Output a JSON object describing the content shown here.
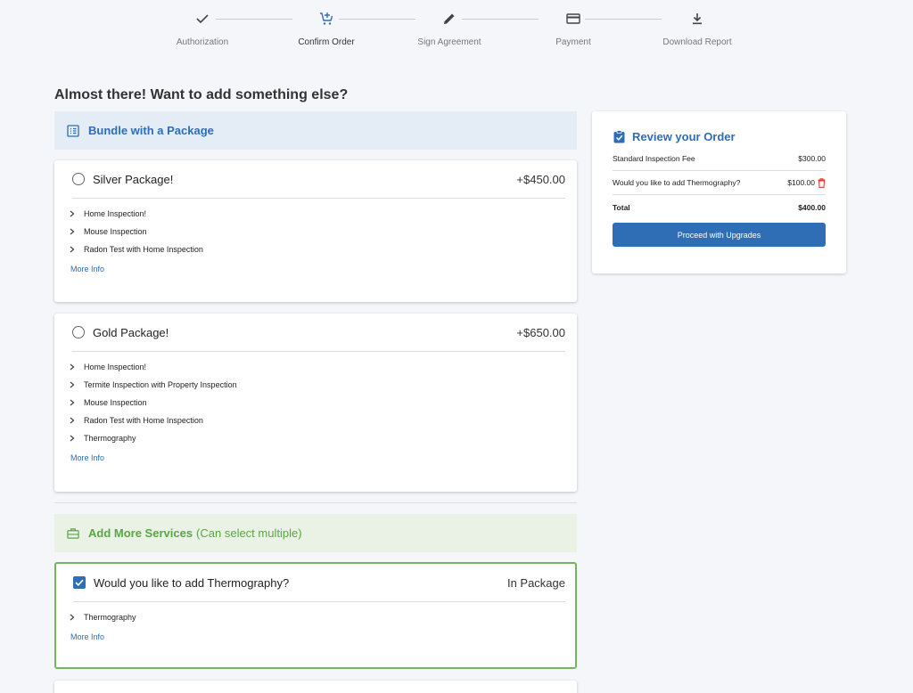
{
  "stepper": {
    "steps": [
      {
        "label": "Authorization",
        "icon": "check-icon",
        "active": false
      },
      {
        "label": "Confirm Order",
        "icon": "cart-add-icon",
        "active": true
      },
      {
        "label": "Sign Agreement",
        "icon": "pencil-icon",
        "active": false
      },
      {
        "label": "Payment",
        "icon": "credit-card-icon",
        "active": false
      },
      {
        "label": "Download Report",
        "icon": "download-icon",
        "active": false
      }
    ]
  },
  "page": {
    "title": "Almost there! Want to add something else?"
  },
  "bundle_section": {
    "title": "Bundle with a Package",
    "icon": "list-icon"
  },
  "packages": [
    {
      "name": "Silver Package!",
      "price": "+$450.00",
      "items": [
        "Home Inspection!",
        "Mouse Inspection",
        "Radon Test with Home Inspection"
      ],
      "more_info": "More Info"
    },
    {
      "name": "Gold Package!",
      "price": "+$650.00",
      "items": [
        "Home Inspection!",
        "Termite Inspection with Property Inspection",
        "Mouse Inspection",
        "Radon Test with Home Inspection",
        "Thermography"
      ],
      "more_info": "More Info"
    }
  ],
  "services_section": {
    "title": "Add More Services",
    "subtitle": "(Can select multiple)",
    "icon": "briefcase-icon"
  },
  "services": [
    {
      "name": "Would you like to add Thermography?",
      "status": "In Package",
      "checked": true,
      "items": [
        "Thermography"
      ],
      "more_info": "More Info"
    }
  ],
  "review": {
    "title": "Review your Order",
    "icon": "clipboard-check-icon",
    "rows": [
      {
        "label": "Standard Inspection Fee",
        "amount": "$300.00"
      },
      {
        "label": "Would you like to add Thermography?",
        "amount": "$100.00"
      }
    ],
    "total_label": "Total",
    "total_amount": "$400.00",
    "button_label": "Proceed with Upgrades"
  },
  "colors": {
    "accent": "#2f6db5",
    "success": "#77b462",
    "danger": "#e53935"
  }
}
